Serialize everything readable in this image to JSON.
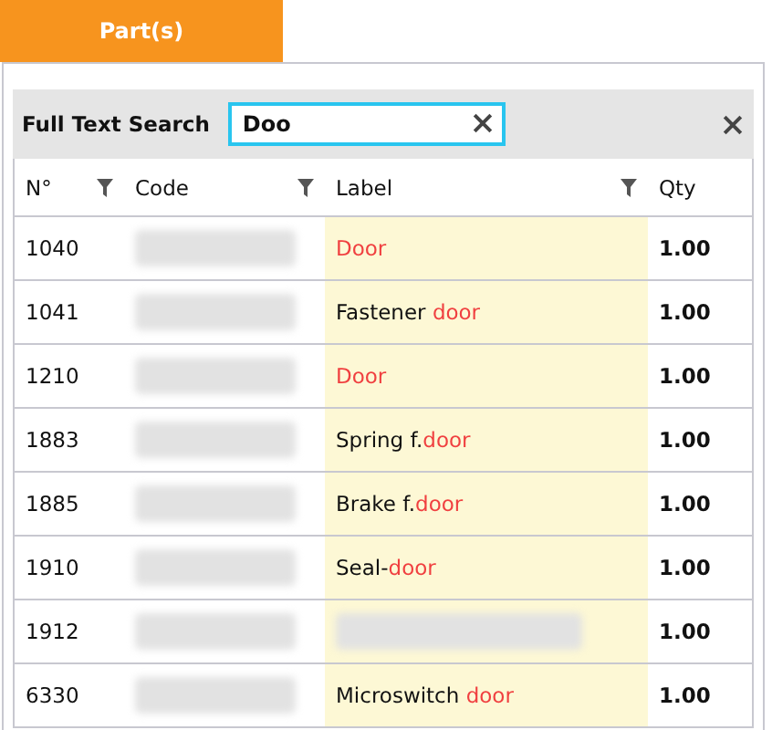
{
  "tabs": [
    {
      "label": "Part(s)",
      "selected": true
    }
  ],
  "search": {
    "label": "Full Text Search",
    "value": "Doo"
  },
  "table": {
    "columns": [
      {
        "label": "N°",
        "filter": true
      },
      {
        "label": "Code",
        "filter": true
      },
      {
        "label": "Label",
        "filter": true
      },
      {
        "label": "Qty",
        "filter": false
      }
    ],
    "rows": [
      {
        "number": "1040",
        "label": [
          {
            "text": "Door",
            "match": true
          }
        ],
        "blurred": false,
        "qty": "1.00"
      },
      {
        "number": "1041",
        "label": [
          {
            "text": "Fastener ",
            "match": false
          },
          {
            "text": "door",
            "match": true
          }
        ],
        "blurred": false,
        "qty": "1.00"
      },
      {
        "number": "1210",
        "label": [
          {
            "text": "Door",
            "match": true
          }
        ],
        "blurred": false,
        "qty": "1.00"
      },
      {
        "number": "1883",
        "label": [
          {
            "text": "Spring f.",
            "match": false
          },
          {
            "text": "door",
            "match": true
          }
        ],
        "blurred": false,
        "qty": "1.00"
      },
      {
        "number": "1885",
        "label": [
          {
            "text": "Brake f.",
            "match": false
          },
          {
            "text": "door",
            "match": true
          }
        ],
        "blurred": false,
        "qty": "1.00"
      },
      {
        "number": "1910",
        "label": [
          {
            "text": "Seal-",
            "match": false
          },
          {
            "text": "door",
            "match": true
          }
        ],
        "blurred": false,
        "qty": "1.00"
      },
      {
        "number": "1912",
        "label": [],
        "blurred": true,
        "qty": "1.00"
      },
      {
        "number": "6330",
        "label": [
          {
            "text": "Microswitch ",
            "match": false
          },
          {
            "text": "door",
            "match": true
          }
        ],
        "blurred": false,
        "qty": "1.00"
      }
    ]
  }
}
